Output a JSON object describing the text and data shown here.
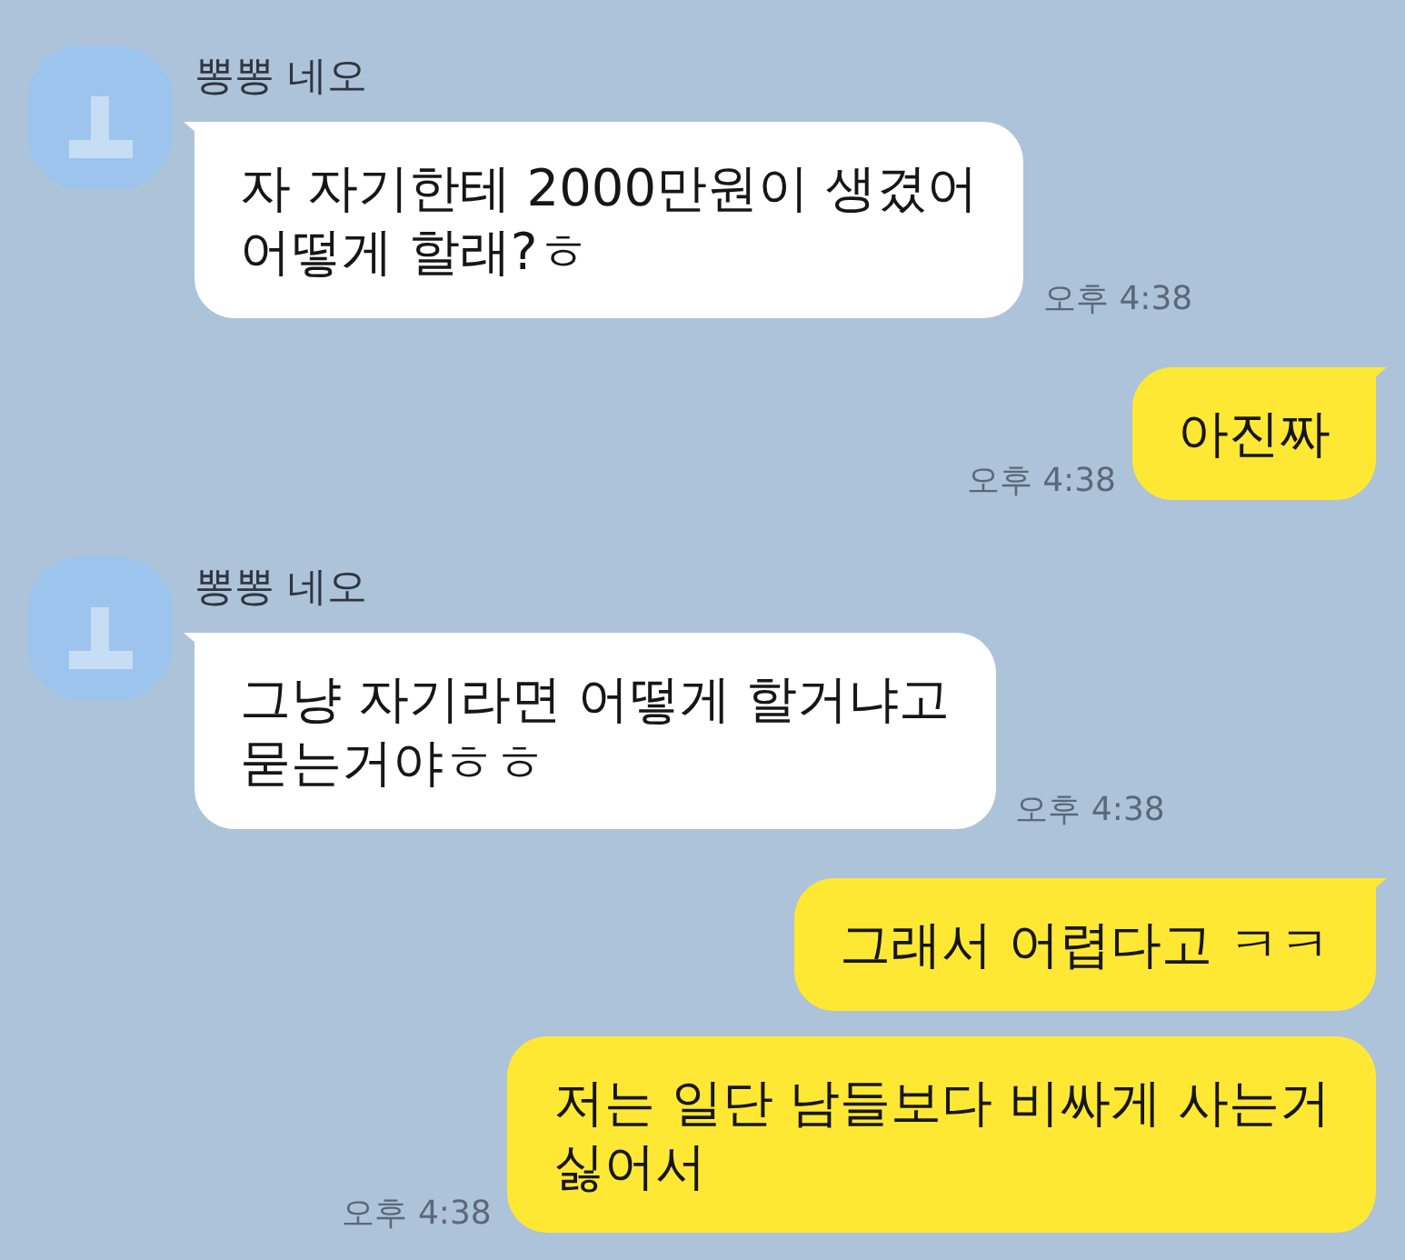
{
  "messages": [
    {
      "kind": "received",
      "sender": "뽕뽕 네오",
      "text": "자 자기한테 2000만원이 생겼어\n어떻게 할래?ㅎ",
      "time": "오후 4:38",
      "tail": true
    },
    {
      "kind": "sent",
      "text": "아진짜",
      "time": "오후 4:38",
      "tail": true
    },
    {
      "kind": "received",
      "sender": "뽕뽕 네오",
      "text": "그냥 자기라면 어떻게 할거냐고\n묻는거야ㅎㅎ",
      "time": "오후 4:38",
      "tail": true
    },
    {
      "kind": "sent",
      "text": "그래서 어렵다고 ㅋㅋ",
      "tail": true
    },
    {
      "kind": "sent",
      "text": "저는 일단 남들보다 비싸게 사는거\n싫어서",
      "time": "오후 4:38",
      "tail": false
    }
  ]
}
